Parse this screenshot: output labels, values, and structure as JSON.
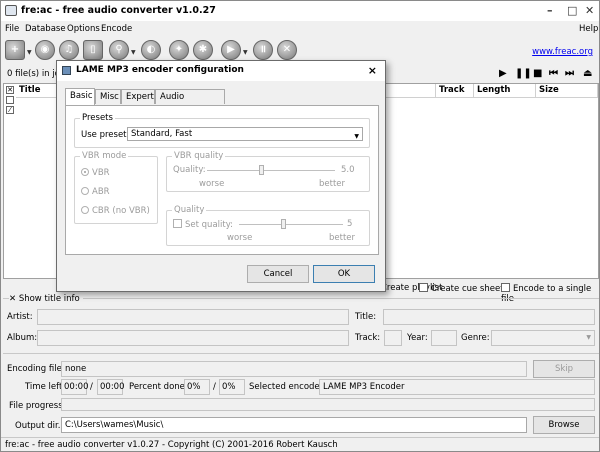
{
  "window": {
    "title": "fre:ac - free audio converter v1.0.27",
    "minimize": "–",
    "maximize": "□",
    "close": "✕"
  },
  "menu": {
    "file": "File",
    "database": "Database",
    "options": "Options",
    "encode": "Encode",
    "help": "Help"
  },
  "toolbar": {
    "link": "www.freac.org"
  },
  "joblist": {
    "count_text": "0 file(s) in joblist",
    "columns": {
      "title": "Title",
      "track": "Track",
      "length": "Length",
      "size": "Size"
    }
  },
  "options_row": {
    "playlist": "Create playlist",
    "cue": "Create cue sheet",
    "single": "Encode to a single file"
  },
  "title_info": {
    "toggle": "Show title info",
    "artist": "Artist:",
    "title": "Title:",
    "album": "Album:",
    "track": "Track:",
    "year": "Year:",
    "genre": "Genre:"
  },
  "encoding": {
    "file_label": "Encoding file:",
    "file_value": "none",
    "skip": "Skip",
    "time_left_label": "Time left:",
    "time_left": "00:00",
    "slash": "/",
    "time_total": "00:00",
    "percent_label": "Percent done:",
    "percent": "0%",
    "percent_total": "0%",
    "encoder_label": "Selected encoder:",
    "encoder_value": "LAME MP3 Encoder",
    "progress_label": "File progress:",
    "output_label": "Output dir.:",
    "output_value": "C:\\Users\\wames\\Music\\",
    "browse": "Browse"
  },
  "status": "fre:ac - free audio converter v1.0.27 - Copyright (C) 2001-2016 Robert Kausch",
  "dialog": {
    "title": "LAME MP3 encoder configuration",
    "close": "×",
    "tabs": [
      "Basic",
      "Misc",
      "Expert",
      "Audio processing"
    ],
    "presets_group": "Presets",
    "use_preset_label": "Use preset:",
    "preset_value": "Standard, Fast",
    "vbr_mode_group": "VBR mode",
    "vbr_modes": [
      "VBR",
      "ABR",
      "CBR (no VBR)"
    ],
    "vbr_quality_group": "VBR quality",
    "vbr_quality_label": "Quality:",
    "vbr_quality_value": "5.0",
    "worse": "worse",
    "better": "better",
    "quality_group": "Quality",
    "set_quality_label": "Set quality:",
    "set_quality_value": "5",
    "cancel": "Cancel",
    "ok": "OK"
  }
}
